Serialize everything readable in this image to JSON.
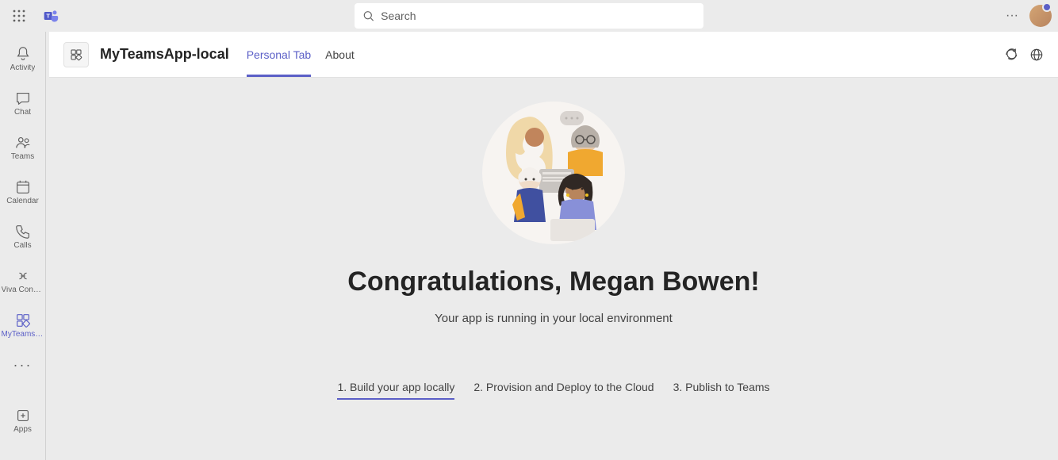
{
  "search": {
    "placeholder": "Search"
  },
  "rail": {
    "items": [
      {
        "id": "activity",
        "label": "Activity"
      },
      {
        "id": "chat",
        "label": "Chat"
      },
      {
        "id": "teams",
        "label": "Teams"
      },
      {
        "id": "calendar",
        "label": "Calendar"
      },
      {
        "id": "calls",
        "label": "Calls"
      },
      {
        "id": "viva",
        "label": "Viva Connec..."
      },
      {
        "id": "myteamsapp",
        "label": "MyTeamsA..."
      }
    ],
    "apps_label": "Apps"
  },
  "header": {
    "app_title": "MyTeamsApp-local",
    "tabs": [
      {
        "label": "Personal Tab",
        "active": true
      },
      {
        "label": "About",
        "active": false
      }
    ]
  },
  "body": {
    "congrats": "Congratulations, Megan Bowen!",
    "subtitle": "Your app is running in your local environment",
    "steps": [
      {
        "label": "1. Build your app locally",
        "active": true
      },
      {
        "label": "2. Provision and Deploy to the Cloud",
        "active": false
      },
      {
        "label": "3. Publish to Teams",
        "active": false
      }
    ]
  }
}
